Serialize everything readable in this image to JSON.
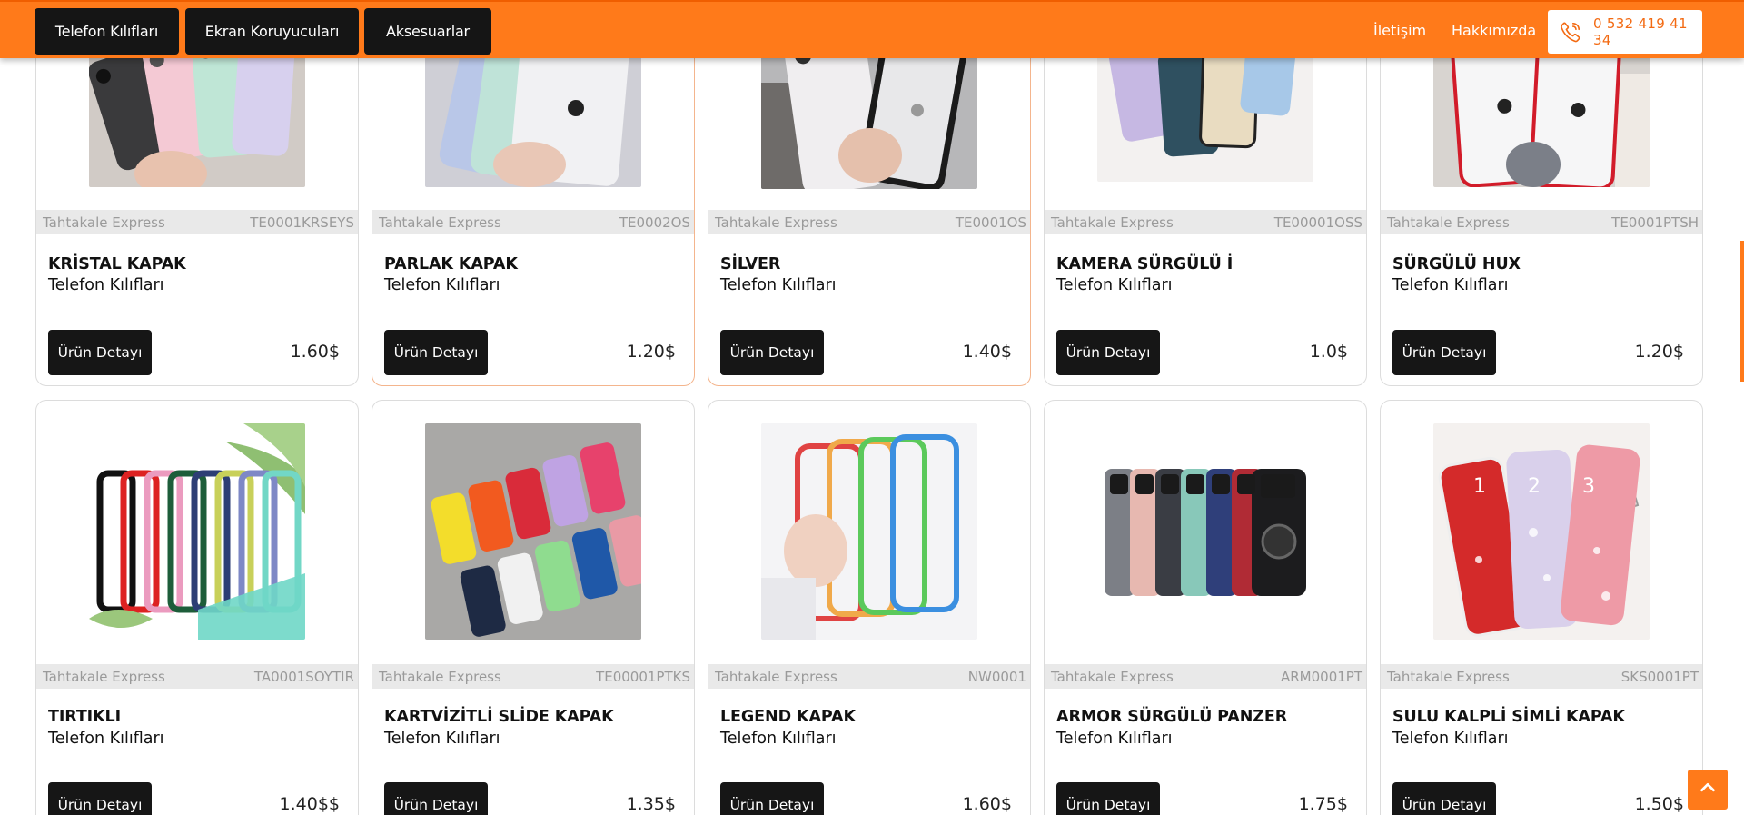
{
  "header": {
    "nav": [
      "Telefon Kılıfları",
      "Ekran Koruyucuları",
      "Aksesuarlar"
    ],
    "contact": "İletişim",
    "about": "Hakkımızda",
    "phone": "0 532 419 41 34",
    "phone_icon": "phone-icon"
  },
  "colors": {
    "brand": "#ff7a1a",
    "dark": "#151515",
    "meta_bg": "#e9e9e9"
  },
  "detail_label": "Ürün Detayı",
  "products": [
    {
      "brand": "Tahtakale Express",
      "code": "TE0001KRSEYS",
      "name": "KRİSTAL KAPAK",
      "category": "Telefon Kılıfları",
      "price": "1.60$"
    },
    {
      "brand": "Tahtakale Express",
      "code": "TE0002OS",
      "name": "PARLAK KAPAK",
      "category": "Telefon Kılıfları",
      "price": "1.20$"
    },
    {
      "brand": "Tahtakale Express",
      "code": "TE0001OS",
      "name": "SİLVER",
      "category": "Telefon Kılıfları",
      "price": "1.40$"
    },
    {
      "brand": "Tahtakale Express",
      "code": "TE00001OSS",
      "name": "KAMERA SÜRGÜLÜ İ",
      "category": "Telefon Kılıfları",
      "price": "1.0$"
    },
    {
      "brand": "Tahtakale Express",
      "code": "TE0001PTSH",
      "name": "SÜRGÜLÜ HUX",
      "category": "Telefon Kılıfları",
      "price": "1.20$"
    },
    {
      "brand": "Tahtakale Express",
      "code": "TA0001SOYTIR",
      "name": "TIRTIKLI",
      "category": "Telefon Kılıfları",
      "price": "1.40$$"
    },
    {
      "brand": "Tahtakale Express",
      "code": "TE00001PTKS",
      "name": "KARTVİZİTLİ SLİDE KAPAK",
      "category": "Telefon Kılıfları",
      "price": "1.35$"
    },
    {
      "brand": "Tahtakale Express",
      "code": "NW0001",
      "name": "LEGEND KAPAK",
      "category": "Telefon Kılıfları",
      "price": "1.60$"
    },
    {
      "brand": "Tahtakale Express",
      "code": "ARM0001PT",
      "name": "ARMOR SÜRGÜLÜ PANZER",
      "category": "Telefon Kılıfları",
      "price": "1.75$"
    },
    {
      "brand": "Tahtakale Express",
      "code": "SKS0001PT",
      "name": "SULU KALPLİ SİMLİ KAPAK",
      "category": "Telefon Kılıfları",
      "price": "1.50$"
    }
  ],
  "image_numbers": [
    "1",
    "2",
    "3"
  ],
  "back_to_top_icon": "chevron-up-icon"
}
